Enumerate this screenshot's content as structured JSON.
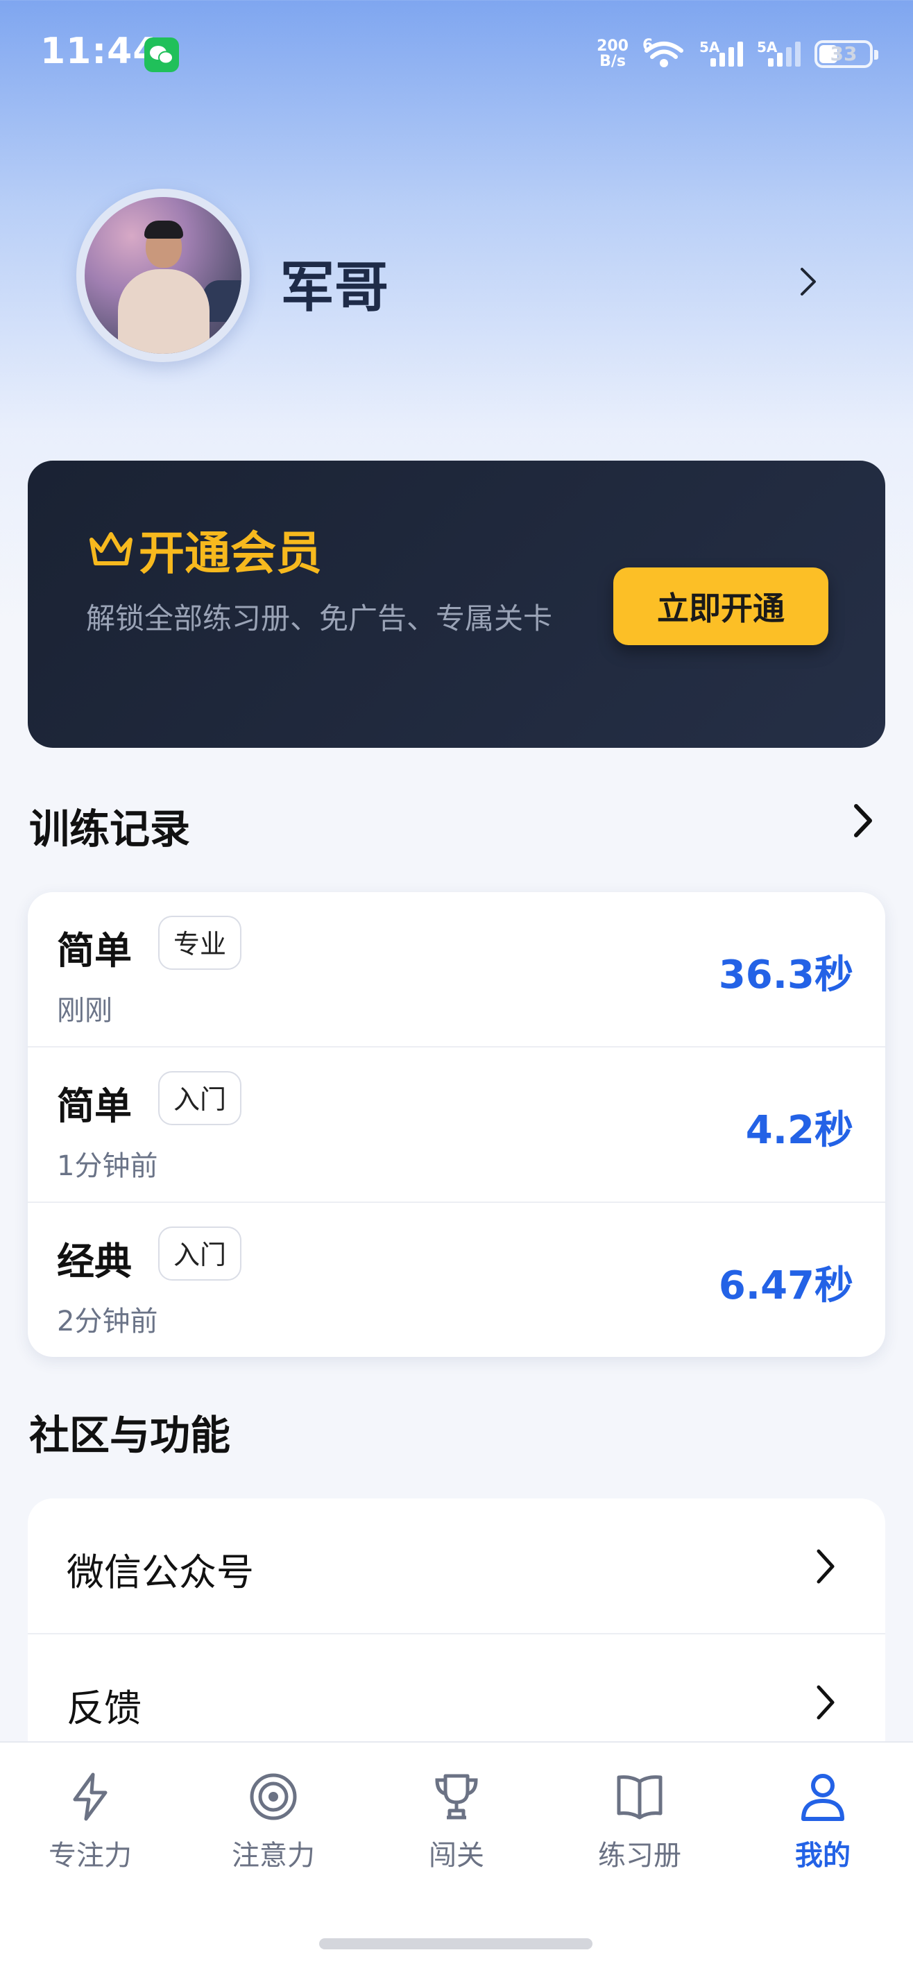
{
  "status_bar": {
    "time": "11:44",
    "net_speed_value": "200",
    "net_speed_unit": "B/s",
    "wifi_label": "6",
    "signal1_label": "5A",
    "signal2_label": "5A",
    "battery": "33"
  },
  "profile": {
    "name": "军哥"
  },
  "membership": {
    "title": "开通会员",
    "description": "解锁全部练习册、免广告、专属关卡",
    "button": "立即开通",
    "accent_color": "#FCBF26"
  },
  "records": {
    "title": "训练记录",
    "items": [
      {
        "name": "简单",
        "tag": "专业",
        "time": "刚刚",
        "score": "36.3秒"
      },
      {
        "name": "简单",
        "tag": "入门",
        "time": "1分钟前",
        "score": "4.2秒"
      },
      {
        "name": "经典",
        "tag": "入门",
        "time": "2分钟前",
        "score": "6.47秒"
      }
    ]
  },
  "community": {
    "title": "社区与功能",
    "items": [
      {
        "label": "微信公众号"
      },
      {
        "label": "反馈"
      }
    ]
  },
  "bottom_nav": {
    "active_color": "#2362E6",
    "items": [
      {
        "label": "专注力",
        "icon": "lightning-icon",
        "active": false
      },
      {
        "label": "注意力",
        "icon": "target-icon",
        "active": false
      },
      {
        "label": "闯关",
        "icon": "trophy-icon",
        "active": false
      },
      {
        "label": "练习册",
        "icon": "book-icon",
        "active": false
      },
      {
        "label": "我的",
        "icon": "user-icon",
        "active": true
      }
    ]
  }
}
